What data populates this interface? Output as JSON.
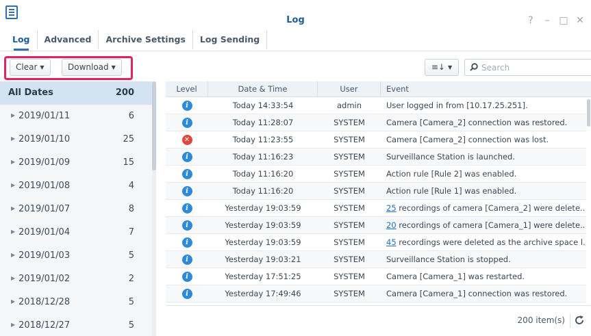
{
  "window": {
    "title": "Log",
    "controls": [
      "?",
      "–",
      "□",
      "✕"
    ]
  },
  "tabs": [
    {
      "label": "Log",
      "active": true
    },
    {
      "label": "Advanced",
      "active": false
    },
    {
      "label": "Archive Settings",
      "active": false
    },
    {
      "label": "Log Sending",
      "active": false
    }
  ],
  "toolbar": {
    "clear_label": "Clear",
    "download_label": "Download",
    "sort_icon": "sort-list-icon",
    "search_placeholder": "Search"
  },
  "dates": [
    {
      "label": "All Dates",
      "count": "200",
      "selected": true
    },
    {
      "label": "2019/01/11",
      "count": "6"
    },
    {
      "label": "2019/01/10",
      "count": "25"
    },
    {
      "label": "2019/01/09",
      "count": "15"
    },
    {
      "label": "2019/01/08",
      "count": "4"
    },
    {
      "label": "2019/01/07",
      "count": "8"
    },
    {
      "label": "2019/01/04",
      "count": "7"
    },
    {
      "label": "2019/01/03",
      "count": "5"
    },
    {
      "label": "2019/01/02",
      "count": "2"
    },
    {
      "label": "2018/12/28",
      "count": "5"
    },
    {
      "label": "2018/12/27",
      "count": "5"
    }
  ],
  "columns": [
    "Level",
    "Date & Time",
    "User",
    "Event"
  ],
  "rows": [
    {
      "level": "info",
      "date": "Today 14:33:54",
      "user": "admin",
      "event_link": "",
      "event": "User logged in from [10.17.25.251]."
    },
    {
      "level": "info",
      "date": "Today 11:28:07",
      "user": "SYSTEM",
      "event_link": "",
      "event": "Camera [Camera_2] connection was restored."
    },
    {
      "level": "error",
      "date": "Today 11:23:55",
      "user": "SYSTEM",
      "event_link": "",
      "event": "Camera [Camera_2] connection was lost."
    },
    {
      "level": "info",
      "date": "Today 11:16:23",
      "user": "SYSTEM",
      "event_link": "",
      "event": "Surveillance Station is launched."
    },
    {
      "level": "info",
      "date": "Today 11:16:20",
      "user": "SYSTEM",
      "event_link": "",
      "event": "Action rule [Rule 2] was enabled."
    },
    {
      "level": "info",
      "date": "Today 11:16:20",
      "user": "SYSTEM",
      "event_link": "",
      "event": "Action rule [Rule 1] was enabled."
    },
    {
      "level": "info",
      "date": "Yesterday 19:03:59",
      "user": "SYSTEM",
      "event_link": "25",
      "event": " recordings of camera [Camera_2] were delete..."
    },
    {
      "level": "info",
      "date": "Yesterday 19:03:59",
      "user": "SYSTEM",
      "event_link": "20",
      "event": " recordings of camera [Camera_1] were delete..."
    },
    {
      "level": "info",
      "date": "Yesterday 19:03:59",
      "user": "SYSTEM",
      "event_link": "45",
      "event": " recordings were deleted as the archive space l..."
    },
    {
      "level": "info",
      "date": "Yesterday 19:03:21",
      "user": "SYSTEM",
      "event_link": "",
      "event": "Surveillance Station is stopped."
    },
    {
      "level": "info",
      "date": "Yesterday 17:51:25",
      "user": "SYSTEM",
      "event_link": "",
      "event": "Camera [Camera_1] was restarted."
    },
    {
      "level": "info",
      "date": "Yesterday 17:49:46",
      "user": "SYSTEM",
      "event_link": "",
      "event": "Camera [Camera_1] connection was restored."
    }
  ],
  "footer": {
    "count_label": "200 item(s)"
  },
  "colors": {
    "accent": "#2f6fb1",
    "highlight": "#e1245c",
    "info": "#2d8ad7",
    "error": "#e0483e",
    "selected": "#d3e3f1"
  }
}
